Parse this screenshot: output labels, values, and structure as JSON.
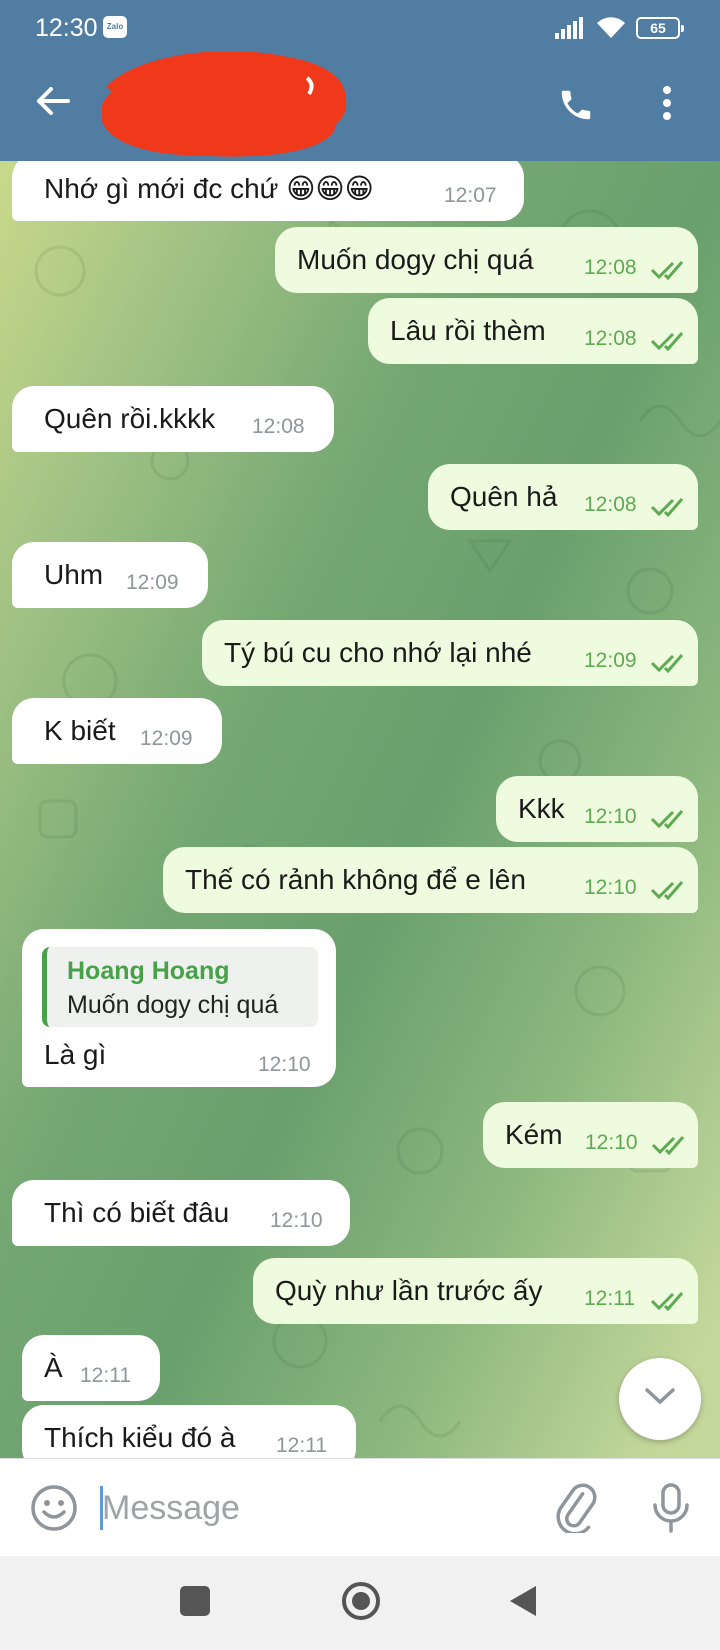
{
  "status_bar": {
    "time": "12:30",
    "notification_app": "Zalo",
    "battery": "65"
  },
  "header": {
    "title": "",
    "title_redacted": true,
    "icons": [
      "back-arrow-icon",
      "phone-icon",
      "more-vert-icon"
    ]
  },
  "messages": [
    {
      "dir": "in",
      "text": "Nhớ gì mới đc chứ 😁😁😁",
      "time": "12:07"
    },
    {
      "dir": "out",
      "text": "Muốn dogy chị quá",
      "time": "12:08",
      "read": true
    },
    {
      "dir": "out",
      "text": "Lâu rồi thèm",
      "time": "12:08",
      "read": true
    },
    {
      "dir": "in",
      "text": "Quên rồi.kkkk",
      "time": "12:08"
    },
    {
      "dir": "out",
      "text": "Quên hả",
      "time": "12:08",
      "read": true
    },
    {
      "dir": "in",
      "text": "Uhm",
      "time": "12:09"
    },
    {
      "dir": "out",
      "text": "Tý bú cu cho nhớ lại nhé",
      "time": "12:09",
      "read": true
    },
    {
      "dir": "in",
      "text": "K biết",
      "time": "12:09"
    },
    {
      "dir": "out",
      "text": "Kkk",
      "time": "12:10",
      "read": true
    },
    {
      "dir": "out",
      "text": "Thế có rảnh không để e lên",
      "time": "12:10",
      "read": true
    },
    {
      "dir": "out",
      "text": "Kém",
      "time": "12:10",
      "read": true
    },
    {
      "dir": "in",
      "text": "Thì có biết đâu",
      "time": "12:10"
    },
    {
      "dir": "out",
      "text": "Quỳ như lần trước ấy",
      "time": "12:11",
      "read": true
    },
    {
      "dir": "in",
      "text": "À",
      "time": "12:11"
    },
    {
      "dir": "in",
      "text": "Thích kiểu đó à",
      "time": "12:11"
    }
  ],
  "reply_message": {
    "quoted_name": "Hoang Hoang",
    "quoted_text": "Muốn dogy chị quá",
    "text": "Là gì",
    "time": "12:10"
  },
  "input": {
    "placeholder": "Message",
    "value": ""
  },
  "colors": {
    "header": "#527da3",
    "incoming_bubble": "#ffffff",
    "outgoing_bubble": "#eefbde",
    "outgoing_time": "#5eaa53",
    "reply_accent": "#47a148"
  }
}
